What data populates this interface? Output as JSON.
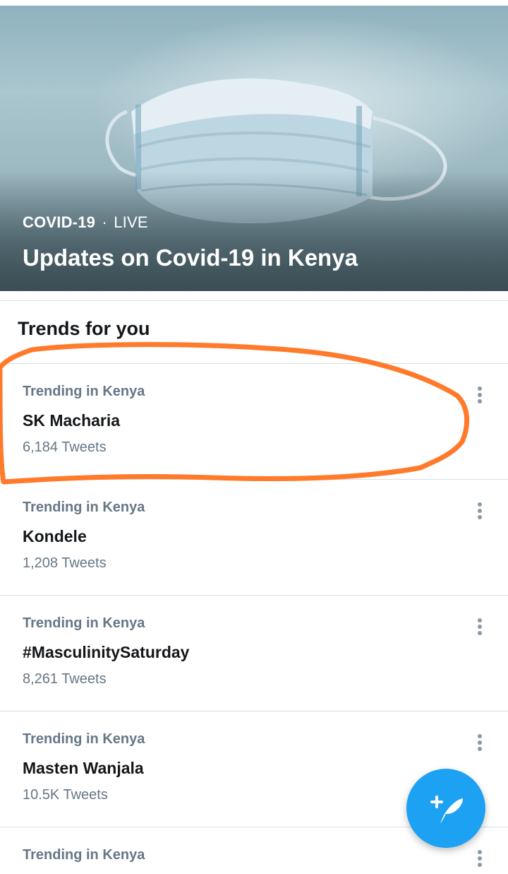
{
  "hero": {
    "topic": "COVID-19",
    "separator": "·",
    "status": "LIVE",
    "title": "Updates on Covid-19 in Kenya",
    "image": "surgical-mask-photo"
  },
  "section": {
    "title": "Trends for you"
  },
  "trends": [
    {
      "context": "Trending in Kenya",
      "name": "SK Macharia",
      "count": "6,184 Tweets"
    },
    {
      "context": "Trending in Kenya",
      "name": "Kondele",
      "count": "1,208 Tweets"
    },
    {
      "context": "Trending in Kenya",
      "name": "#MasculinitySaturday",
      "count": "8,261 Tweets"
    },
    {
      "context": "Trending in Kenya",
      "name": "Masten Wanjala",
      "count": "10.5K Tweets"
    },
    {
      "context": "Trending in Kenya",
      "name": "",
      "count": ""
    }
  ],
  "icons": {
    "more": "more-vertical-icon",
    "compose": "compose-tweet-icon"
  },
  "colors": {
    "accent": "#1da1f2",
    "secondary_text": "#657786",
    "primary_text": "#14171a",
    "annotation": "#ff7a2a"
  }
}
